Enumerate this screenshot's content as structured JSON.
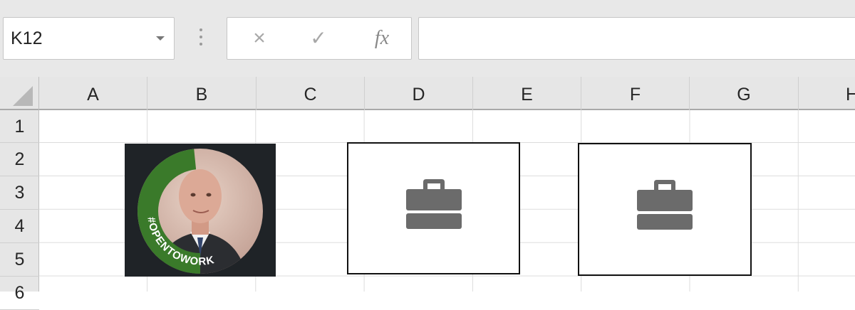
{
  "name_box": {
    "value": "K12"
  },
  "formula_bar": {
    "cancel_icon": "×",
    "enter_icon": "✓",
    "fx_label": "fx",
    "value": ""
  },
  "columns": [
    "A",
    "B",
    "C",
    "D",
    "E",
    "F",
    "G",
    "H"
  ],
  "rows": [
    "1",
    "2",
    "3",
    "4",
    "5",
    "6"
  ],
  "profile_badge": {
    "text": "#OPENTOWORK",
    "ring_color": "#3a7a2a"
  },
  "placeholders": [
    {
      "icon": "briefcase-icon",
      "color": "#6b6b6b"
    },
    {
      "icon": "briefcase-icon",
      "color": "#6b6b6b"
    }
  ]
}
